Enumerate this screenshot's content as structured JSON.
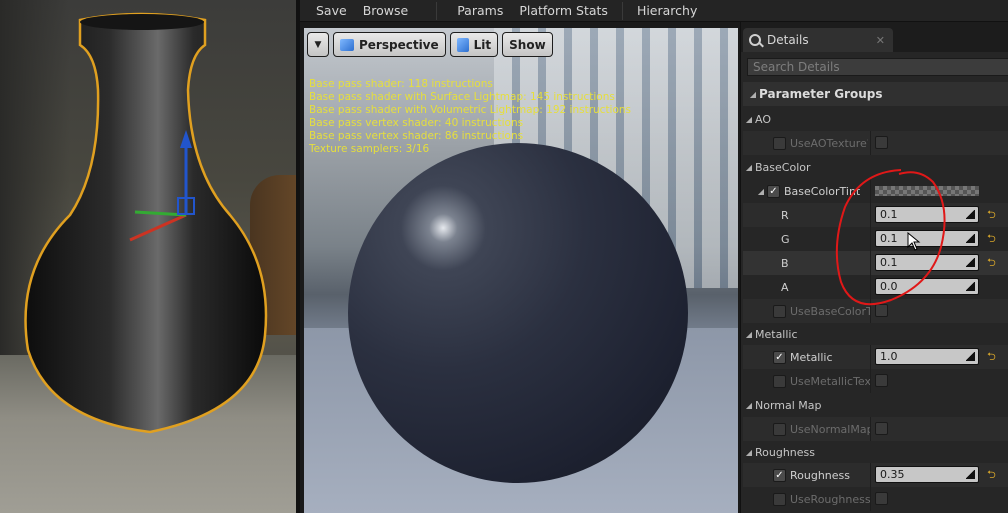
{
  "toolbar": {
    "save": "Save",
    "browse": "Browse",
    "params": "Params",
    "platform_stats": "Platform Stats",
    "hierarchy": "Hierarchy"
  },
  "viewport": {
    "perspective": "Perspective",
    "lit": "Lit",
    "show": "Show",
    "stats": [
      "Base pass shader: 118 instructions",
      "Base pass shader with Surface Lightmap: 145 instructions",
      "Base pass shader with Volumetric Lightmap: 192 instructions",
      "Base pass vertex shader: 40 instructions",
      "Base pass vertex shader: 86 instructions",
      "Texture samplers: 3/16"
    ]
  },
  "details": {
    "tab_title": "Details",
    "search_placeholder": "Search Details",
    "group_header": "Parameter Groups",
    "ao": {
      "label": "AO",
      "use_tex": "UseAOTexture?"
    },
    "basecolor": {
      "label": "BaseColor",
      "tint": "BaseColorTint",
      "r_label": "R",
      "r": "0.1",
      "g_label": "G",
      "g": "0.1",
      "b_label": "B",
      "b": "0.1",
      "a_label": "A",
      "a": "0.0",
      "use_tex": "UseBaseColorTe"
    },
    "metallic": {
      "label": "Metallic",
      "param": "Metallic",
      "value": "1.0",
      "use_tex": "UseMetallicTex"
    },
    "normal": {
      "label": "Normal Map",
      "use_tex": "UseNormalMap"
    },
    "roughness": {
      "label": "Roughness",
      "param": "Roughness",
      "value": "0.35",
      "use_tex": "UseRoughnessT"
    }
  },
  "colors": {
    "stats_text": "#e6df3c",
    "selection_outline": "#e0a020",
    "annotation": "#e01818"
  }
}
